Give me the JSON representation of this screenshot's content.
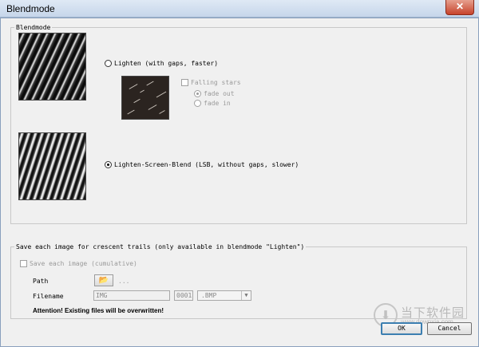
{
  "window": {
    "title": "Blendmode",
    "close_glyph": "✕"
  },
  "blendmode_group": {
    "legend": "Blendmode",
    "lighten_label": "Lighten (with gaps, faster)",
    "lighten_selected": false,
    "falling_stars_label": "Falling stars",
    "falling_stars_checked": false,
    "fade_out_label": "fade out",
    "fade_out_selected": true,
    "fade_in_label": "fade in",
    "fade_in_selected": false,
    "lsb_label": "Lighten-Screen-Blend (LSB, without gaps, slower)",
    "lsb_selected": true
  },
  "save_group": {
    "legend": "Save each image for crescent trails (only available in blendmode \"Lighten\")",
    "save_each_label": "Save each image (cumulative)",
    "save_each_checked": false,
    "path_label": "Path",
    "folder_icon": "folder-open-icon",
    "path_value": "...",
    "filename_label": "Filename",
    "filename_value": "IMG",
    "counter_value": "0001",
    "format_value": ".BMP",
    "warning": "Attention! Existing files will be overwritten!"
  },
  "buttons": {
    "ok_label": "OK",
    "cancel_label": "Cancel"
  },
  "watermark": {
    "logo_glyph": "⬇",
    "chinese_text": "当下软件园",
    "url": "www.downxia.com"
  }
}
